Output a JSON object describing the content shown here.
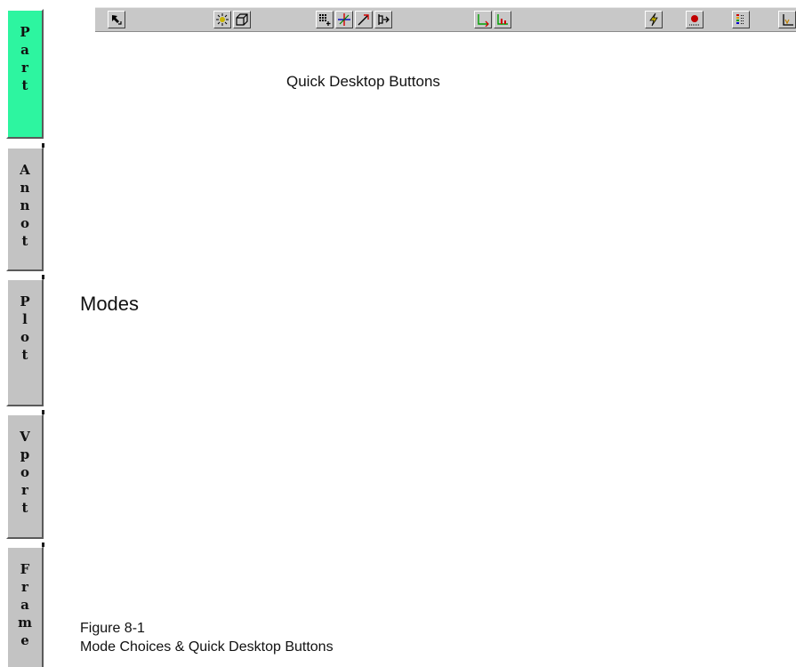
{
  "modes": [
    {
      "id": "part",
      "label": "Part",
      "active": true
    },
    {
      "id": "annot",
      "label": "Annot",
      "active": false
    },
    {
      "id": "plot",
      "label": "Plot",
      "active": false
    },
    {
      "id": "vport",
      "label": "Vport",
      "active": false
    },
    {
      "id": "frame",
      "label": "Frame",
      "active": false
    }
  ],
  "toolbar": {
    "buttons": [
      {
        "name": "pointer-select-icon"
      },
      {
        "name": "lighting-icon"
      },
      {
        "name": "view-cube-icon"
      },
      {
        "name": "add-zone-icon"
      },
      {
        "name": "translate-axes-icon"
      },
      {
        "name": "vector-icon"
      },
      {
        "name": "probe-icon"
      },
      {
        "name": "xy-axis-icon"
      },
      {
        "name": "bar-axis-icon"
      },
      {
        "name": "lightning-redraw-icon"
      },
      {
        "name": "scatter-point-icon"
      },
      {
        "name": "contour-colormap-icon"
      },
      {
        "name": "stream-icon"
      }
    ]
  },
  "captions": {
    "title": "Quick Desktop Buttons",
    "modes": "Modes",
    "figure_number": "Figure 8-1",
    "figure_caption": "Mode Choices & Quick Desktop Buttons"
  },
  "colors": {
    "active_mode": "#2df5a0",
    "button_face": "#c3c3c3"
  }
}
